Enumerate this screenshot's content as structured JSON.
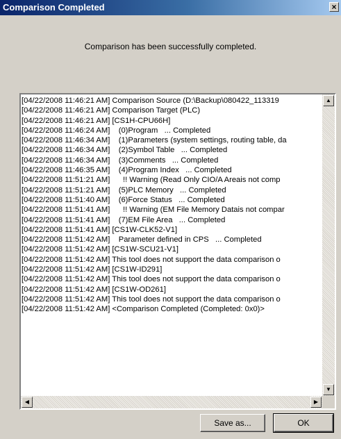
{
  "window": {
    "title": "Comparison Completed",
    "close_label": "×"
  },
  "message": "Comparison has been successfully completed.",
  "log": [
    "[04/22/2008 11:46:21 AM] Comparison Source (D:\\Backup\\080422_113319",
    "[04/22/2008 11:46:21 AM] Comparison Target (PLC)",
    "[04/22/2008 11:46:21 AM] [CS1H-CPU66H]",
    "[04/22/2008 11:46:24 AM]    (0)Program   ... Completed",
    "[04/22/2008 11:46:34 AM]    (1)Parameters (system settings, routing table, da",
    "[04/22/2008 11:46:34 AM]    (2)Symbol Table   ... Completed",
    "[04/22/2008 11:46:34 AM]    (3)Comments   ... Completed",
    "[04/22/2008 11:46:35 AM]    (4)Program Index   ... Completed",
    "[04/22/2008 11:51:21 AM]      !! Warning (Read Only CIO/A Areais not comp",
    "[04/22/2008 11:51:21 AM]    (5)PLC Memory   ... Completed",
    "[04/22/2008 11:51:40 AM]    (6)Force Status   ... Completed",
    "[04/22/2008 11:51:41 AM]      !! Warning (EM File Memory Datais not compar",
    "[04/22/2008 11:51:41 AM]    (7)EM File Area   ... Completed",
    "[04/22/2008 11:51:41 AM] [CS1W-CLK52-V1]",
    "[04/22/2008 11:51:42 AM]    Parameter defined in CPS   ... Completed",
    "[04/22/2008 11:51:42 AM] [CS1W-SCU21-V1]",
    "[04/22/2008 11:51:42 AM] This tool does not support the data comparison o",
    "[04/22/2008 11:51:42 AM] [CS1W-ID291]",
    "[04/22/2008 11:51:42 AM] This tool does not support the data comparison o",
    "[04/22/2008 11:51:42 AM] [CS1W-OD261]",
    "[04/22/2008 11:51:42 AM] This tool does not support the data comparison o",
    "[04/22/2008 11:51:42 AM] <Comparison Completed (Completed: 0x0)>"
  ],
  "scrollbar": {
    "up_arrow": "▲",
    "down_arrow": "▼",
    "left_arrow": "◀",
    "right_arrow": "▶"
  },
  "buttons": {
    "save_as": "Save as...",
    "ok": "OK"
  },
  "colors": {
    "titlebar": "#0a246a",
    "face": "#d4d0c8"
  }
}
